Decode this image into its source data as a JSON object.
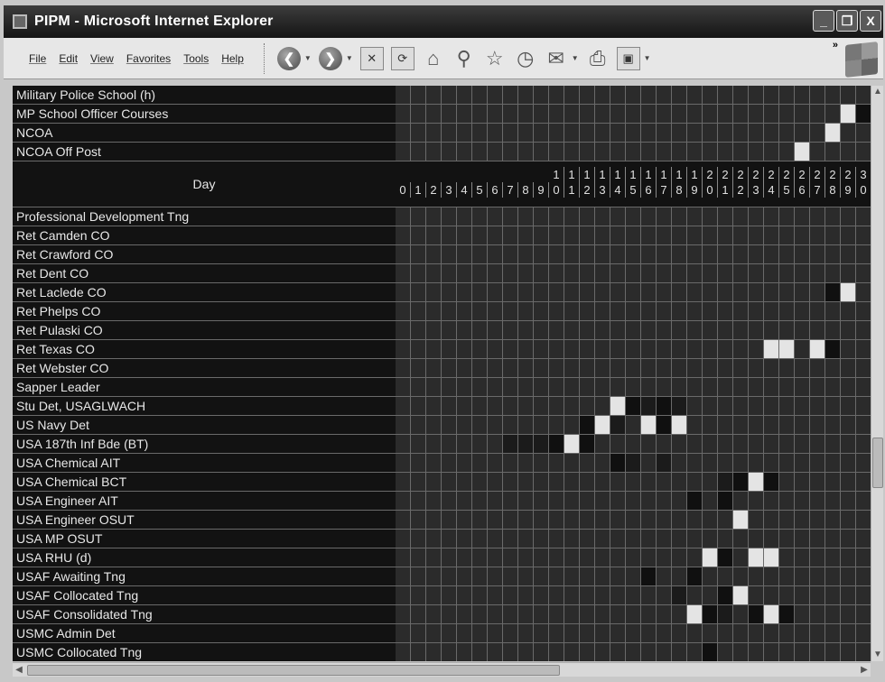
{
  "window": {
    "title": "PIPM - Microsoft Internet Explorer",
    "buttons": [
      "_",
      "❐",
      "X"
    ]
  },
  "menu": [
    "File",
    "Edit",
    "View",
    "Favorites",
    "Tools",
    "Help"
  ],
  "toolbar": {
    "buttons": [
      {
        "icon": "back-icon",
        "glyph": "❮"
      },
      {
        "icon": "forward-icon",
        "glyph": "❯"
      },
      {
        "icon": "stop-icon",
        "glyph": "✕"
      },
      {
        "icon": "refresh-icon",
        "glyph": "⟳"
      },
      {
        "icon": "home-icon",
        "glyph": "⌂"
      },
      {
        "icon": "search-icon",
        "glyph": "⚲"
      },
      {
        "icon": "favorites-icon",
        "glyph": "☆"
      },
      {
        "icon": "history-icon",
        "glyph": "◷"
      },
      {
        "icon": "mail-icon",
        "glyph": "✉"
      },
      {
        "icon": "print-icon",
        "glyph": "⎙"
      },
      {
        "icon": "edit-icon",
        "glyph": "▣"
      }
    ],
    "more": "»"
  },
  "table": {
    "rows_top": [
      "Military Police School (h)",
      "MP School Officer Courses",
      "NCOA",
      "NCOA Off Post"
    ],
    "day_label": "Day",
    "day_tens": [
      "",
      "",
      "",
      "",
      "",
      "",
      "",
      "",
      "",
      "",
      "1",
      "1",
      "1",
      "1",
      "1",
      "1",
      "1",
      "1",
      "1",
      "1",
      "2",
      "2",
      "2",
      "2",
      "2",
      "2",
      "2",
      "2",
      "2",
      "2",
      "3"
    ],
    "day_ones": [
      "0",
      "1",
      "2",
      "3",
      "4",
      "5",
      "6",
      "7",
      "8",
      "9",
      "0",
      "1",
      "2",
      "3",
      "4",
      "5",
      "6",
      "7",
      "8",
      "9",
      "0",
      "1",
      "2",
      "3",
      "4",
      "5",
      "6",
      "7",
      "8",
      "9",
      "0"
    ],
    "rows_bottom": [
      "Professional Development Tng",
      "Ret Camden CO",
      "Ret Crawford CO",
      "Ret Dent CO",
      "Ret Laclede CO",
      "Ret Phelps CO",
      "Ret Pulaski CO",
      "Ret Texas CO",
      "Ret Webster CO",
      "Sapper Leader",
      "Stu Det, USAGLWACH",
      "US Navy Det",
      "USA 187th Inf Bde (BT)",
      "USA Chemical AIT",
      "USA Chemical BCT",
      "USA Engineer AIT",
      "USA Engineer OSUT",
      "USA MP OSUT",
      "USA RHU (d)",
      "USAF Awaiting Tng",
      "USAF Collocated Tng",
      "USAF Consolidated Tng",
      "USMC Admin Det",
      "USMC Collocated Tng"
    ],
    "highlights": [
      {
        "row": "MP School Officer Courses",
        "cells": [
          [
            29,
            3
          ],
          [
            30,
            2
          ]
        ]
      },
      {
        "row": "NCOA",
        "cells": [
          [
            28,
            3
          ]
        ]
      },
      {
        "row": "NCOA Off Post",
        "cells": [
          [
            26,
            3
          ]
        ]
      },
      {
        "row": "Ret Laclede CO",
        "cells": [
          [
            28,
            2
          ],
          [
            29,
            3
          ]
        ]
      },
      {
        "row": "Ret Texas CO",
        "cells": [
          [
            24,
            3
          ],
          [
            25,
            3
          ],
          [
            27,
            3
          ],
          [
            28,
            2
          ]
        ]
      },
      {
        "row": "Stu Det, USAGLWACH",
        "cells": [
          [
            14,
            3
          ],
          [
            15,
            2
          ],
          [
            16,
            1
          ],
          [
            17,
            2
          ],
          [
            18,
            1
          ]
        ]
      },
      {
        "row": "US Navy Det",
        "cells": [
          [
            12,
            2
          ],
          [
            13,
            3
          ],
          [
            14,
            1
          ],
          [
            16,
            3
          ],
          [
            17,
            2
          ],
          [
            18,
            3
          ]
        ]
      },
      {
        "row": "USA 187th Inf Bde (BT)",
        "cells": [
          [
            7,
            1
          ],
          [
            8,
            1
          ],
          [
            9,
            1
          ],
          [
            10,
            2
          ],
          [
            11,
            3
          ],
          [
            12,
            2
          ]
        ]
      },
      {
        "row": "USA Chemical AIT",
        "cells": [
          [
            14,
            2
          ],
          [
            15,
            1
          ],
          [
            17,
            1
          ]
        ]
      },
      {
        "row": "USA Chemical BCT",
        "cells": [
          [
            21,
            1
          ],
          [
            22,
            2
          ],
          [
            23,
            3
          ],
          [
            24,
            2
          ]
        ]
      },
      {
        "row": "USA Engineer AIT",
        "cells": [
          [
            19,
            2
          ],
          [
            21,
            2
          ]
        ]
      },
      {
        "row": "USA Engineer OSUT",
        "cells": [
          [
            22,
            3
          ]
        ]
      },
      {
        "row": "USA RHU (d)",
        "cells": [
          [
            20,
            3
          ],
          [
            21,
            2
          ],
          [
            23,
            3
          ],
          [
            24,
            3
          ]
        ]
      },
      {
        "row": "USAF Awaiting Tng",
        "cells": [
          [
            16,
            2
          ],
          [
            19,
            2
          ]
        ]
      },
      {
        "row": "USAF Collocated Tng",
        "cells": [
          [
            18,
            1
          ],
          [
            21,
            2
          ],
          [
            22,
            3
          ]
        ]
      },
      {
        "row": "USAF Consolidated Tng",
        "cells": [
          [
            19,
            3
          ],
          [
            20,
            2
          ],
          [
            21,
            1
          ],
          [
            23,
            2
          ],
          [
            24,
            3
          ],
          [
            25,
            2
          ]
        ]
      },
      {
        "row": "USMC Collocated Tng",
        "cells": [
          [
            20,
            2
          ]
        ]
      }
    ]
  }
}
